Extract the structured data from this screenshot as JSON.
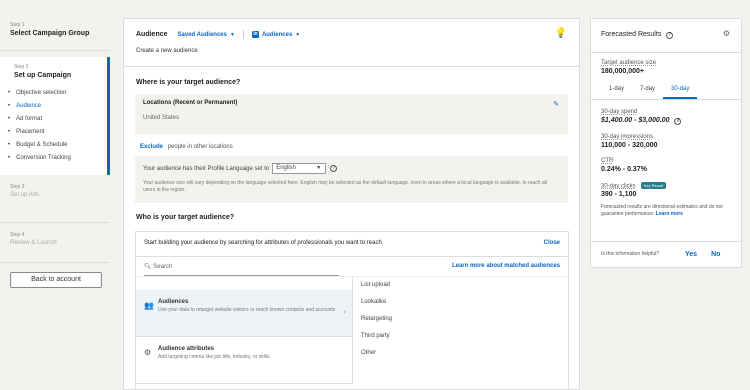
{
  "sidebar": {
    "step1": {
      "num": "Step 1",
      "title": "Select Campaign Group"
    },
    "step2": {
      "num": "Step 2",
      "title": "Set up Campaign",
      "items": [
        "Objective selection",
        "Audience",
        "Ad format",
        "Placement",
        "Budget & Schedule",
        "Conversion Tracking"
      ]
    },
    "step3": {
      "num": "Step 3",
      "title": "Set up Ads"
    },
    "step4": {
      "num": "Step 4",
      "title": "Review & Launch"
    },
    "back_label": "Back to account"
  },
  "header": {
    "title": "Audience",
    "saved_label": "Saved Audiences",
    "audiences_label": "Audiences",
    "li_glyph": "in",
    "subtitle": "Create a new audience"
  },
  "audience": {
    "where_q": "Where is your target audience?",
    "location_title": "Locations (Recent or Permanent)",
    "location_value": "United States",
    "exclude_label": "Exclude",
    "exclude_text": "people in other locations",
    "lang_prefix": "Your audience has their Profile Language set to",
    "lang_value": "English",
    "lang_note": "Your audience size will vary depending on the language selected here. English may be selected as the default language, even in areas where a local language is available, to reach all users in the region.",
    "who_q": "Who is your target audience?"
  },
  "builder": {
    "prompt": "Start building your audience by searching for attributes of professionals you want to reach",
    "close_label": "Close",
    "search_placeholder": "Search",
    "learn_label": "Learn more about matched audiences",
    "categories": [
      {
        "title": "Audiences",
        "desc": "Use your data to retarget website visitors or reach known contacts and accounts"
      },
      {
        "title": "Audience attributes",
        "desc": "Add targeting criteria like job title, industry, or skills"
      }
    ],
    "options": [
      "List upload",
      "Lookalike",
      "Retargeting",
      "Third party",
      "Other"
    ]
  },
  "forecast": {
    "title": "Forecasted Results",
    "target_label": "Target audience size",
    "target_value": "180,000,000+",
    "tabs": [
      "1-day",
      "7-day",
      "30-day"
    ],
    "active_tab": "30-day",
    "spend_label": "30-day spend",
    "spend_value": "$1,400.00 - $3,000.00",
    "impr_label": "30-day impressions",
    "impr_value": "110,000 - 320,000",
    "ctr_label": "CTR",
    "ctr_value": "0.24% - 0.37%",
    "clicks_label": "30-day clicks",
    "clicks_badge": "Key Result",
    "clicks_value": "390 - 1,100",
    "note": "Forecasted results are directional estimates and do not guarantee performance.",
    "learn_more": "Learn more",
    "helpful_q": "Is this information helpful?",
    "yes_label": "Yes",
    "no_label": "No"
  }
}
